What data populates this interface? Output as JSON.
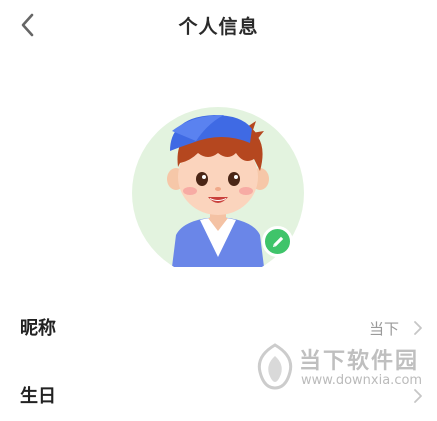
{
  "header": {
    "title": "个人信息",
    "back_icon": "chevron-left-icon"
  },
  "profile": {
    "avatar_icon": "cartoon-boy-avatar",
    "edit_icon": "pencil-icon",
    "accent_color": "#3fc46a"
  },
  "rows": [
    {
      "label": "昵称",
      "value": "当下",
      "chevron_icon": "chevron-right-icon"
    },
    {
      "label": "生日",
      "value": "",
      "chevron_icon": "chevron-right-icon"
    }
  ],
  "watermark": {
    "title": "当下软件园",
    "url": "www.downxia.com"
  }
}
